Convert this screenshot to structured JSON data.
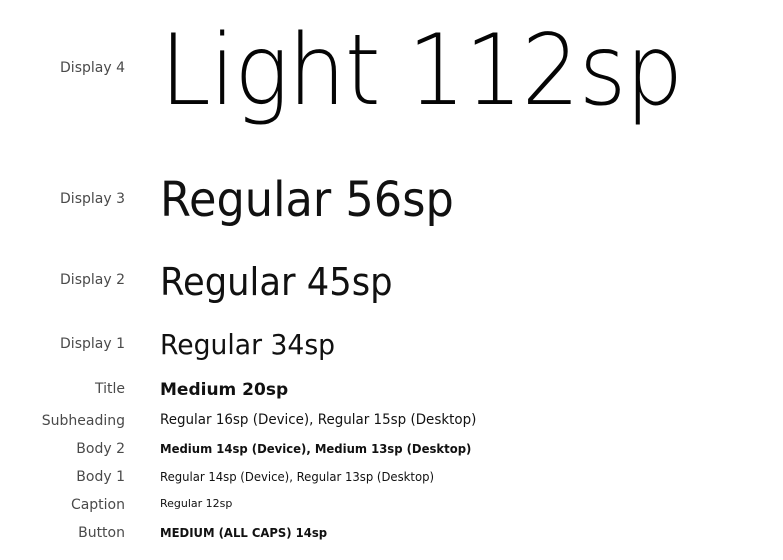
{
  "type_scale": {
    "display4": {
      "label": "Display 4",
      "sample": "Light 112sp"
    },
    "display3": {
      "label": "Display 3",
      "sample": "Regular 56sp"
    },
    "display2": {
      "label": "Display 2",
      "sample": "Regular 45sp"
    },
    "display1": {
      "label": "Display 1",
      "sample": "Regular 34sp"
    },
    "title": {
      "label": "Title",
      "sample": "Medium 20sp"
    },
    "subheading": {
      "label": "Subheading",
      "sample": "Regular 16sp (Device), Regular 15sp (Desktop)"
    },
    "body2": {
      "label": "Body 2",
      "sample": "Medium 14sp (Device), Medium 13sp (Desktop)"
    },
    "body1": {
      "label": "Body 1",
      "sample": "Regular 14sp (Device), Regular 13sp (Desktop)"
    },
    "caption": {
      "label": "Caption",
      "sample": "Regular 12sp"
    },
    "button": {
      "label": "Button",
      "sample": "MEDIUM (ALL CAPS) 14sp"
    }
  },
  "colors": {
    "background": "#ffffff",
    "label_text": "#4a4a4a",
    "sample_text": "#111111"
  }
}
